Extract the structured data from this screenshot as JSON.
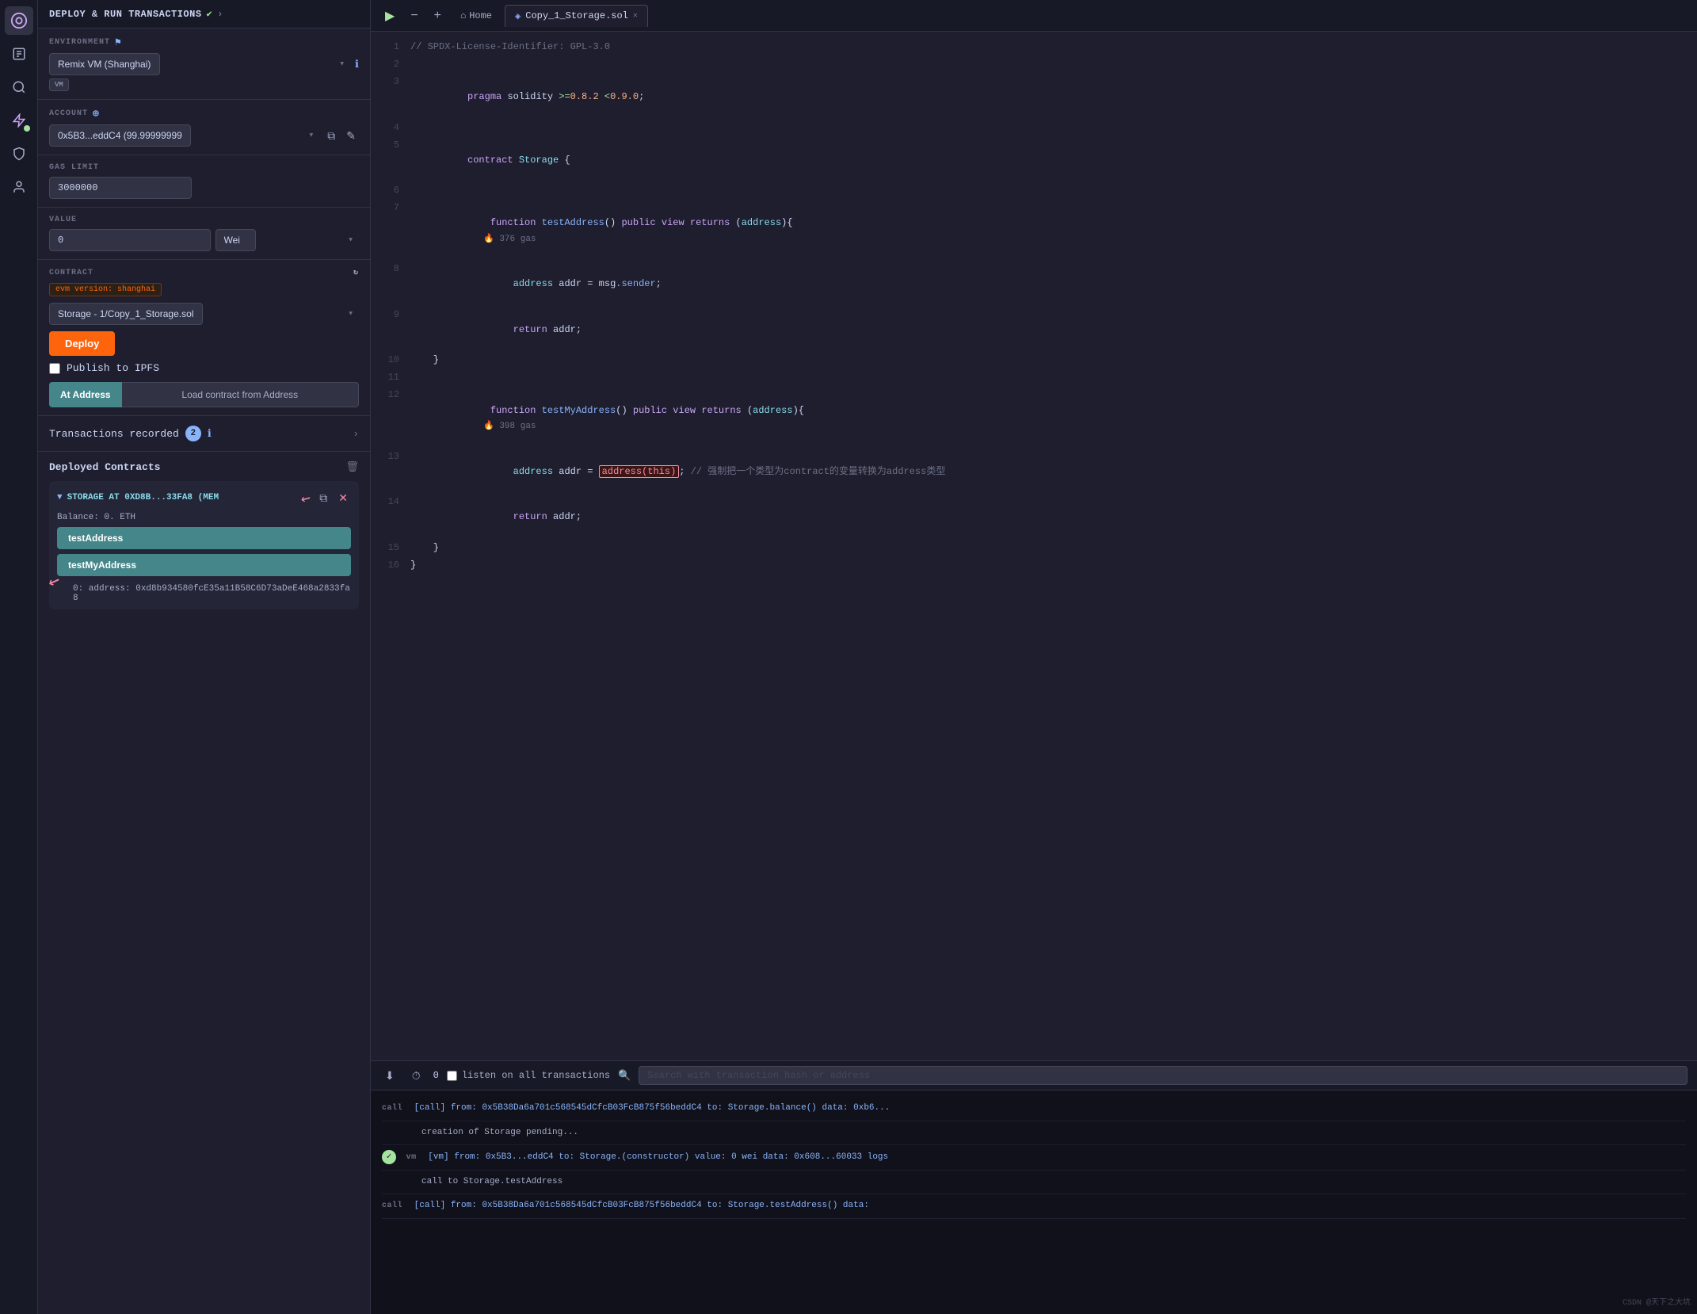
{
  "iconbar": {
    "icons": [
      "🔌",
      "📄",
      "🔍",
      "✔",
      "🔧",
      "👤"
    ]
  },
  "leftPanel": {
    "header": {
      "title": "DEPLOY & RUN TRANSACTIONS",
      "check": "✔",
      "arrow": "›"
    },
    "environment": {
      "label": "ENVIRONMENT",
      "value": "Remix VM (Shanghai)",
      "vmBadge": "VM"
    },
    "account": {
      "label": "ACCOUNT",
      "value": "0x5B3...eddC4 (99.99999999",
      "plusIcon": "⊕"
    },
    "gasLimit": {
      "label": "GAS LIMIT",
      "value": "3000000"
    },
    "value": {
      "label": "VALUE",
      "amount": "0",
      "unit": "Wei"
    },
    "contract": {
      "label": "CONTRACT",
      "value": "Storage - 1/Copy_1_Storage.sol",
      "evmBadge": "evm version: shanghai"
    },
    "deployBtn": "Deploy",
    "publishIpfs": "Publish to IPFS",
    "atAddress": "At Address",
    "loadContract": "Load contract from Address"
  },
  "transactions": {
    "label": "Transactions recorded",
    "count": "2",
    "infoIcon": "ℹ",
    "arrow": "›"
  },
  "deployedContracts": {
    "title": "Deployed Contracts",
    "deleteIcon": "🗑",
    "contracts": [
      {
        "name": "STORAGE AT 0XD8B...33FA8 (MEM",
        "balance": "Balance: 0. ETH",
        "functions": [
          "testAddress",
          "testMyAddress"
        ],
        "output": "0: address: 0xd8b934580fcE35a11B58C6D73aDeE468a2833fa8"
      }
    ]
  },
  "editor": {
    "playBtn": "▶",
    "zoomIn": "+",
    "zoomOut": "−",
    "homeTab": "Home",
    "activeTab": "Copy_1_Storage.sol",
    "lines": [
      {
        "num": 1,
        "content": "// SPDX-License-Identifier: GPL-3.0"
      },
      {
        "num": 2,
        "content": ""
      },
      {
        "num": 3,
        "content": "pragma solidity >=0.8.2 <0.9.0;"
      },
      {
        "num": 4,
        "content": ""
      },
      {
        "num": 5,
        "content": "contract Storage {"
      },
      {
        "num": 6,
        "content": ""
      },
      {
        "num": 7,
        "content": "    function testAddress() public view returns (address){    376 gas"
      },
      {
        "num": 8,
        "content": "        address addr = msg.sender;"
      },
      {
        "num": 9,
        "content": "        return addr;"
      },
      {
        "num": 10,
        "content": "    }"
      },
      {
        "num": 11,
        "content": ""
      },
      {
        "num": 12,
        "content": "    function testMyAddress() public view returns (address){    398 gas"
      },
      {
        "num": 13,
        "content": "        address addr = address(this); // 强制把一个类型为contract的变量转换为address类型"
      },
      {
        "num": 14,
        "content": "        return addr;"
      },
      {
        "num": 15,
        "content": "    }"
      },
      {
        "num": 16,
        "content": "}"
      }
    ]
  },
  "console": {
    "clearBtn": "⬇",
    "histBtn": "⏱",
    "count": "0",
    "listenLabel": "listen on all transactions",
    "searchPlaceholder": "Search with transaction hash or address",
    "entries": [
      {
        "tag": "call",
        "text": "[call] from: 0x5B38Da6a701c568545dCfcB03FcB875f56beddC4 to: Storage.balance() data: 0xb6...",
        "type": "call"
      },
      {
        "tag": "",
        "text": "creation of Storage pending...",
        "type": "pending"
      },
      {
        "tag": "vm",
        "text": "[vm] from: 0x5B3...eddC4 to: Storage.(constructor) value: 0 wei data: 0x608...60033 logs",
        "type": "success"
      },
      {
        "tag": "",
        "text": "call to Storage.testAddress",
        "type": "pending"
      },
      {
        "tag": "call",
        "text": "[call] from: 0x5B38Da6a701c568545dCfcB03FcB875f56beddC4 to: Storage.testAddress() data:",
        "type": "call"
      }
    ]
  },
  "watermark": "CSDN @天下之大坑"
}
